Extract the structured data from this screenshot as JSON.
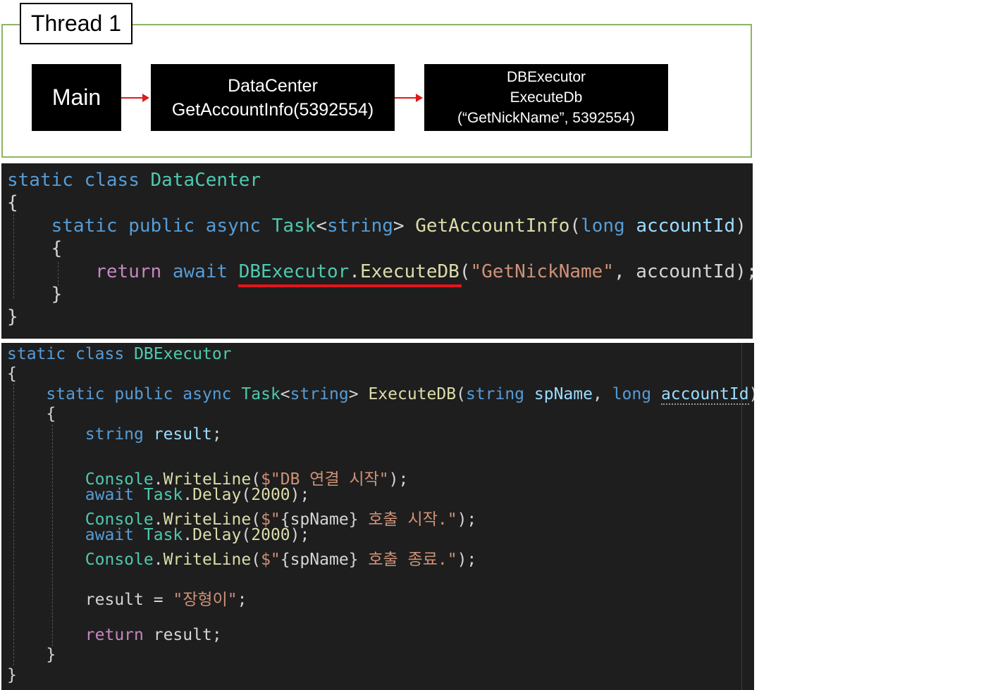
{
  "diagram": {
    "thread_label": "Thread 1",
    "nodes": {
      "main": "Main",
      "datacenter": [
        "DataCenter",
        "GetAccountInfo(5392554)"
      ],
      "dbexecutor": [
        "DBExecutor",
        "ExecuteDb",
        "(“GetNickName”, 5392554)"
      ]
    }
  },
  "code1": {
    "l1": [
      "static",
      " ",
      "class",
      " ",
      "DataCenter"
    ],
    "l2": "{",
    "l3": [
      "    ",
      "static",
      " ",
      "public",
      " ",
      "async",
      " ",
      "Task",
      "<",
      "string",
      "> ",
      "GetAccountInfo",
      "(",
      "long",
      " ",
      "accountId",
      ")"
    ],
    "l4": "    {",
    "l5": [
      "        ",
      "return",
      " ",
      "await",
      " ",
      "DBExecutor",
      ".",
      "ExecuteDB",
      "(",
      "\"GetNickName\"",
      ", accountId);"
    ],
    "l6": "    }",
    "l7": "}"
  },
  "code2": {
    "l1": [
      "static",
      " ",
      "class",
      " ",
      "DBExecutor"
    ],
    "l2": "{",
    "l3": [
      "    ",
      "static",
      " ",
      "public",
      " ",
      "async",
      " ",
      "Task",
      "<",
      "string",
      "> ",
      "ExecuteDB",
      "(",
      "string",
      " ",
      "spName",
      ", ",
      "long",
      " ",
      "accountId",
      ")"
    ],
    "l4": "    {",
    "l5": [
      "        ",
      "string",
      " ",
      "result",
      ";"
    ],
    "l6": [
      "        ",
      "Console",
      ".",
      "WriteLine",
      "(",
      "$\"DB 연결 시작\"",
      ");"
    ],
    "l7": [
      "        ",
      "await",
      " ",
      "Task",
      ".",
      "Delay",
      "(",
      "2000",
      ");"
    ],
    "l8": [
      "        ",
      "Console",
      ".",
      "WriteLine",
      "(",
      "$\"",
      "{spName}",
      " 호출 시작.\"",
      ");"
    ],
    "l9": [
      "        ",
      "await",
      " ",
      "Task",
      ".",
      "Delay",
      "(",
      "2000",
      ");"
    ],
    "l10": [
      "        ",
      "Console",
      ".",
      "WriteLine",
      "(",
      "$\"",
      "{spName}",
      " 호출 종료.\"",
      ");"
    ],
    "l11": [
      "        ",
      "result = ",
      "\"장형이\"",
      ";"
    ],
    "l12": [
      "        ",
      "return",
      " ",
      "result;"
    ],
    "l13": "    }",
    "l14": "}"
  },
  "colors": {
    "keyword": "#569cd6",
    "control": "#c586c0",
    "type": "#4ec9b0",
    "function": "#dcdcaa",
    "string": "#ce9178",
    "parameter": "#9cdcfe",
    "text": "#d4d4d4",
    "background": "#1e1e1e",
    "thread_border": "#8db563",
    "arrow": "#e01b1b"
  }
}
